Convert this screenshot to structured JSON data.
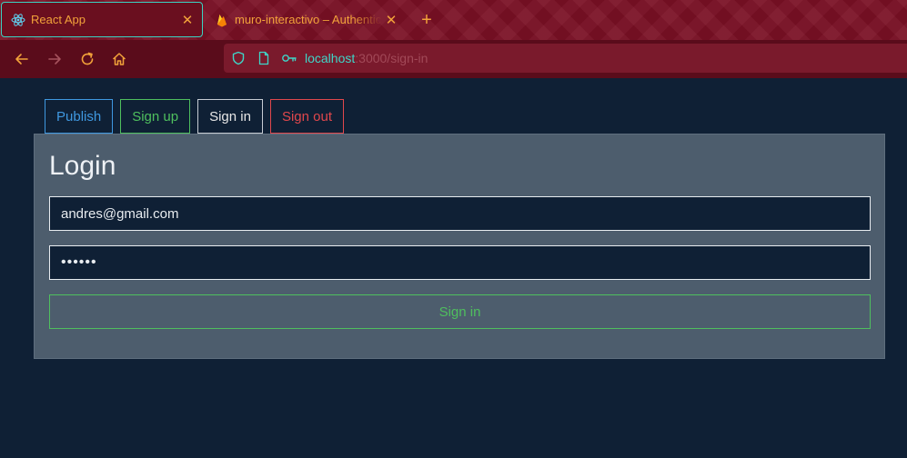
{
  "browser": {
    "tabs": [
      {
        "title": "React App",
        "icon": "react-icon",
        "active": true
      },
      {
        "title": "muro-interactivo – Authentication",
        "icon": "firebase-icon",
        "active": false
      }
    ],
    "url": {
      "host": "localhost",
      "path": ":3000/sign-in"
    },
    "accent_color": "#f2a23a",
    "chrome_color": "#7a1024"
  },
  "nav": {
    "publish": "Publish",
    "sign_up": "Sign up",
    "sign_in": "Sign in",
    "sign_out": "Sign out"
  },
  "login": {
    "title": "Login",
    "email_value": "andres@gmail.com",
    "password_value": "••••••",
    "submit_label": "Sign in"
  },
  "colors": {
    "background": "#0f2035",
    "card": "#4d5d6d",
    "publish": "#3f98e0",
    "sign_up": "#4fbf5e",
    "sign_out": "#e0474c"
  }
}
